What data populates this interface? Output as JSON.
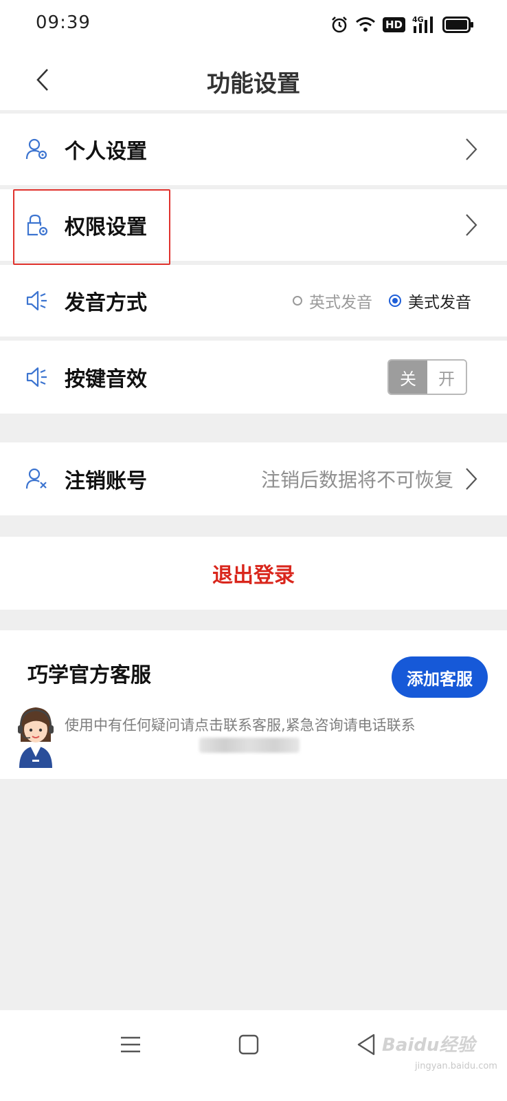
{
  "status_bar": {
    "time": "09:39",
    "icons": [
      "alarm-icon",
      "wifi-icon",
      "hd-icon",
      "4g-signal-icon",
      "battery-icon"
    ],
    "hd_label": "HD",
    "network_label": "4G"
  },
  "header": {
    "title": "功能设置",
    "back_icon": "chevron-left-icon"
  },
  "settings": {
    "personal": {
      "label": "个人设置",
      "icon": "user-gear-icon"
    },
    "permissions": {
      "label": "权限设置",
      "icon": "lock-gear-icon"
    },
    "pronunciation": {
      "label": "发音方式",
      "icon": "speaker-icon",
      "options": [
        {
          "label": "英式发音",
          "selected": false
        },
        {
          "label": "美式发音",
          "selected": true
        }
      ]
    },
    "key_sound": {
      "label": "按键音效",
      "icon": "speaker-icon",
      "toggle_off_label": "关",
      "toggle_on_label": "开",
      "state": "关"
    },
    "cancel_account": {
      "label": "注销账号",
      "icon": "user-remove-icon",
      "hint": "注销后数据将不可恢复"
    }
  },
  "logout": {
    "label": "退出登录"
  },
  "customer_service": {
    "title": "巧学官方客服",
    "add_button": "添加客服",
    "description": "使用中有任何疑问请点击联系客服,紧急咨询请电话联系"
  },
  "bottom_nav": {
    "icons": [
      "menu-icon",
      "home-square-icon",
      "back-triangle-icon"
    ],
    "watermark": "Baidu经验",
    "watermark_sub": "jingyan.baidu.com"
  },
  "colors": {
    "accent_blue": "#1659d8",
    "logout_red": "#d9261c",
    "highlight_red": "#e0322d",
    "background_gray": "#efefef"
  }
}
